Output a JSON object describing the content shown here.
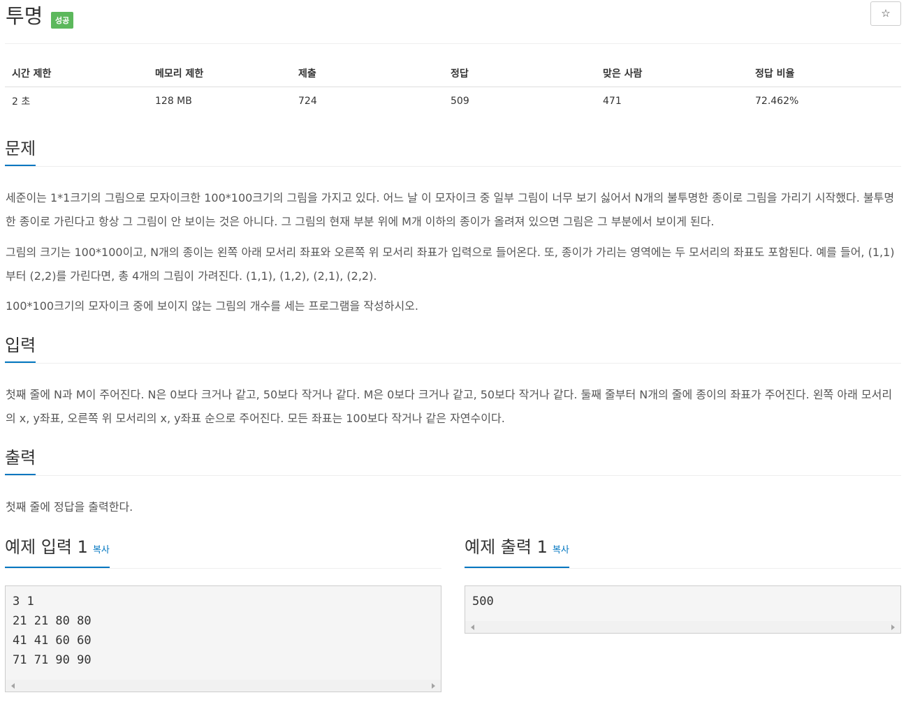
{
  "problem": {
    "title": "투명",
    "badge": "성공",
    "star_icon": "☆"
  },
  "info_table": {
    "headers": [
      "시간 제한",
      "메모리 제한",
      "제출",
      "정답",
      "맞은 사람",
      "정답 비율"
    ],
    "values": [
      "2 초",
      "128 MB",
      "724",
      "509",
      "471",
      "72.462%"
    ]
  },
  "sections": {
    "problem": {
      "heading": "문제",
      "paragraphs": [
        "세준이는 1*1크기의 그림으로 모자이크한 100*100크기의 그림을 가지고 있다. 어느 날 이 모자이크 중 일부 그림이 너무 보기 싫어서 N개의 불투명한 종이로 그림을 가리기 시작했다. 불투명한 종이로 가린다고 항상 그 그림이 안 보이는 것은 아니다. 그 그림의 현재 부분 위에 M개 이하의 종이가 올려져 있으면 그림은 그 부분에서 보이게 된다.",
        "그림의 크기는 100*100이고, N개의 종이는 왼쪽 아래 모서리 좌표와 오른쪽 위 모서리 좌표가 입력으로 들어온다. 또, 종이가 가리는 영역에는 두 모서리의 좌표도 포함된다. 예를 들어, (1,1)부터 (2,2)를 가린다면, 총 4개의 그림이 가려진다. (1,1), (1,2), (2,1), (2,2).",
        "100*100크기의 모자이크 중에 보이지 않는 그림의 개수를 세는 프로그램을 작성하시오."
      ]
    },
    "input": {
      "heading": "입력",
      "text": "첫째 줄에 N과 M이 주어진다. N은 0보다 크거나 같고, 50보다 작거나 같다. M은 0보다 크거나 같고, 50보다 작거나 같다. 둘째 줄부터 N개의 줄에 종이의 좌표가 주어진다. 왼쪽 아래 모서리의 x, y좌표, 오른쪽 위 모서리의 x, y좌표 순으로 주어진다. 모든 좌표는 100보다 작거나 같은 자연수이다."
    },
    "output": {
      "heading": "출력",
      "text": "첫째 줄에 정답을 출력한다."
    }
  },
  "samples": {
    "input": {
      "heading": "예제 입력 1",
      "copy": "복사",
      "lines": [
        "3 1",
        "21 21 80 80",
        "41 41 60 60",
        "71 71 90 90"
      ]
    },
    "output": {
      "heading": "예제 출력 1",
      "copy": "복사",
      "lines": [
        "500"
      ]
    }
  },
  "colors": {
    "accent": "#0076c0",
    "badge": "#5cb85c",
    "code_bg": "#f5f5f5"
  }
}
